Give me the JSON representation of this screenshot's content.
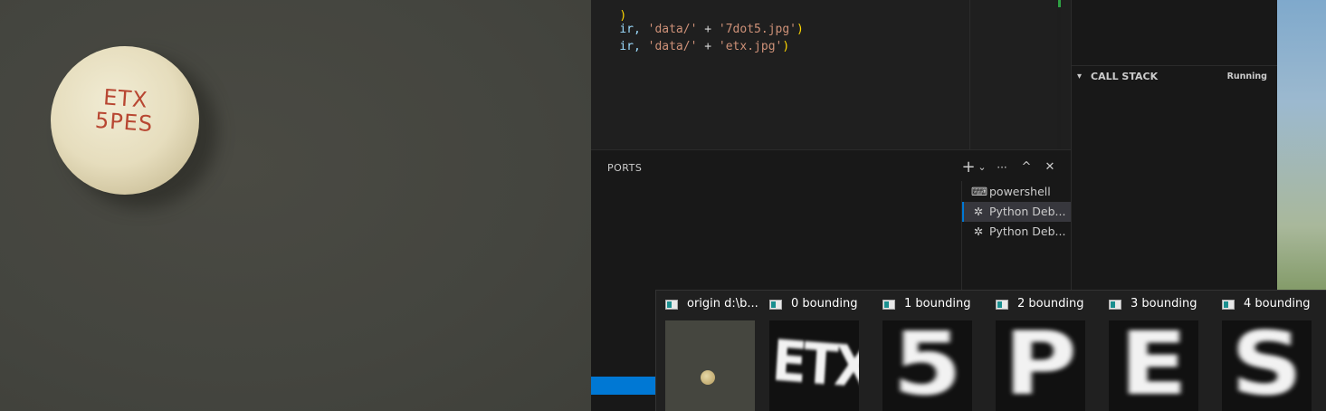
{
  "image_viewer": {
    "pill_imprint_line1": "ETX",
    "pill_imprint_line2": "5PES"
  },
  "editor": {
    "code_lines": [
      {
        "prefix": "ir, ",
        "arg": "'data/'",
        "plus": " + ",
        "file": "'7dot5.jpg'",
        "close": ")"
      },
      {
        "prefix": "ir, ",
        "arg": "'data/'",
        "plus": " + ",
        "file": "'etx.jpg'",
        "close": ")"
      }
    ]
  },
  "panel": {
    "active_tab": "PORTS",
    "actions": {
      "new_terminal": "+",
      "dropdown": "⌄",
      "more": "···",
      "maximize": "^",
      "close": "✕"
    },
    "terminals": [
      {
        "label": "powershell",
        "icon": "terminal-icon",
        "active": false
      },
      {
        "label": "Python Deb...",
        "icon": "debug-bug-icon",
        "active": true
      },
      {
        "label": "Python Deb...",
        "icon": "debug-bug-icon",
        "active": false
      }
    ]
  },
  "debug_sidebar": {
    "call_stack_title": "CALL STACK",
    "call_stack_status": "Running"
  },
  "taskbar_thumbnails": [
    {
      "title": "origin d:\\b...",
      "kind": "origin"
    },
    {
      "title": "0 bounding",
      "glyph": "ETX"
    },
    {
      "title": "1 bounding",
      "glyph": "5"
    },
    {
      "title": "2 bounding",
      "glyph": "P"
    },
    {
      "title": "3 bounding",
      "glyph": "E"
    },
    {
      "title": "4 bounding",
      "glyph": "S"
    }
  ],
  "colors": {
    "accent": "#0078d4",
    "string": "#ce9178",
    "variable": "#9cdcfe",
    "bracket": "#ffd700",
    "pill_imprint": "#b84732"
  }
}
